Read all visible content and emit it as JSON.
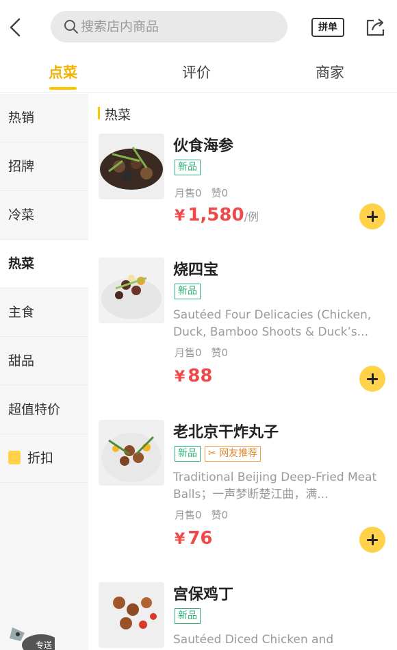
{
  "search": {
    "placeholder": "搜索店内商品"
  },
  "header": {
    "group_order_label": "拼单"
  },
  "tabs": [
    {
      "label": "点菜",
      "active": true
    },
    {
      "label": "评价",
      "active": false
    },
    {
      "label": "商家",
      "active": false
    }
  ],
  "sidebar": {
    "items": [
      {
        "label": "热销"
      },
      {
        "label": "招牌"
      },
      {
        "label": "冷菜"
      },
      {
        "label": "热菜",
        "active": true
      },
      {
        "label": "主食"
      },
      {
        "label": "甜品"
      },
      {
        "label": "超值特价"
      },
      {
        "label": "折扣",
        "icon": "discount-tag-icon"
      }
    ]
  },
  "section": {
    "title": "热菜"
  },
  "items": [
    {
      "name": "伙食海参",
      "badges": [
        "新品"
      ],
      "desc": "",
      "monthly_sales": "月售0",
      "likes": "赞0",
      "currency": "¥",
      "price": "1,580",
      "unit": "/例"
    },
    {
      "name": "烧四宝",
      "badges": [
        "新品"
      ],
      "desc": "Sautéed Four Delicacies (Chicken, Duck, Bamboo Shoots & Duck’s...",
      "monthly_sales": "月售0",
      "likes": "赞0",
      "currency": "¥",
      "price": "88",
      "unit": ""
    },
    {
      "name": "老北京干炸丸子",
      "badges": [
        "新品",
        "网友推荐"
      ],
      "desc": "Traditional Beijing Deep-Fried Meat Balls；一声梦断楚江曲，满...",
      "monthly_sales": "月售0",
      "likes": "赞0",
      "currency": "¥",
      "price": "76",
      "unit": ""
    },
    {
      "name": "宫保鸡丁",
      "badges": [
        "新品"
      ],
      "desc": "Sautéed Diced Chicken and",
      "monthly_sales": "",
      "likes": "",
      "currency": "",
      "price": "",
      "unit": ""
    }
  ],
  "colors": {
    "accent": "#ffc600",
    "price": "#ef4a4a",
    "new_badge": "#2fb079"
  },
  "mascot": {
    "label": "专送"
  }
}
